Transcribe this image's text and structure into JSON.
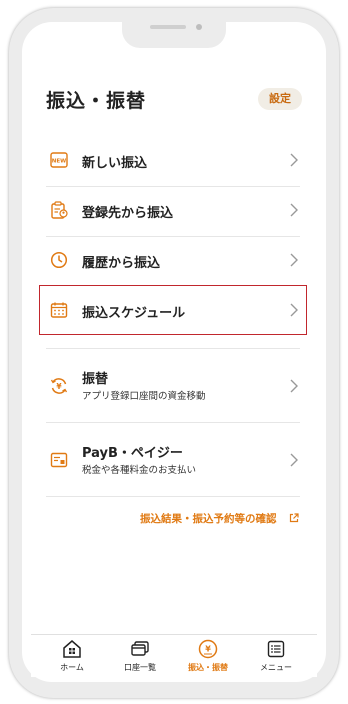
{
  "header": {
    "title": "振込・振替",
    "settings_label": "設定"
  },
  "menu": [
    {
      "label": "新しい振込",
      "icon": "new-badge-icon"
    },
    {
      "label": "登録先から振込",
      "icon": "clipboard-person-icon"
    },
    {
      "label": "履歴から振込",
      "icon": "clock-icon"
    },
    {
      "label": "振込スケジュール",
      "icon": "calendar-icon"
    },
    {
      "label": "振替",
      "sub": "アプリ登録口座間の資金移動",
      "icon": "yen-transfer-icon"
    },
    {
      "label": "PayB・ペイジー",
      "sub": "税金や各種料金のお支払い",
      "icon": "bill-icon"
    }
  ],
  "link": {
    "label": "振込結果・振込予約等の確認",
    "icon": "external-link-icon"
  },
  "tabs": [
    {
      "label": "ホーム",
      "icon": "home-icon"
    },
    {
      "label": "口座一覧",
      "icon": "card-icon"
    },
    {
      "label": "振込・振替",
      "icon": "yen-coin-icon",
      "active": true
    },
    {
      "label": "メニュー",
      "icon": "list-menu-icon"
    }
  ],
  "colors": {
    "accent": "#e07a14",
    "highlight_border": "#c1272d"
  }
}
